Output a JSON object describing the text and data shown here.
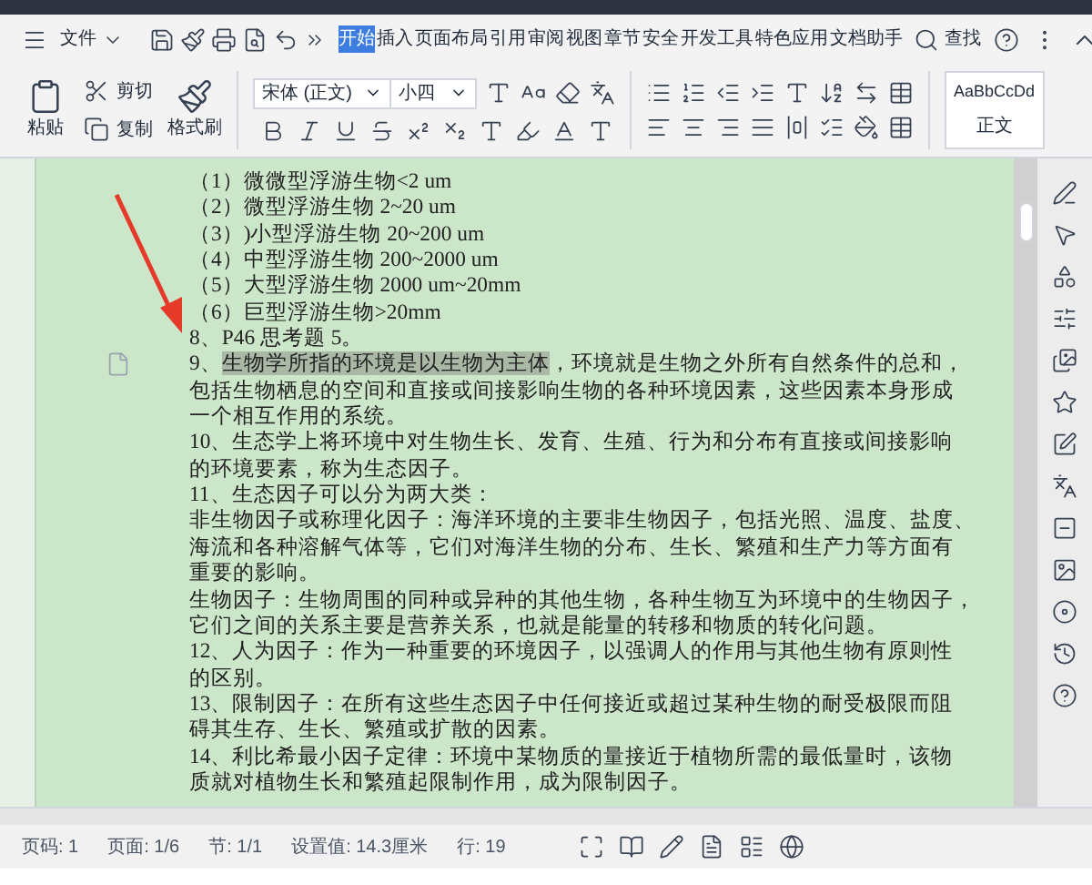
{
  "menu": {
    "file": "文件",
    "tabs": [
      {
        "label": "开始",
        "selected": true
      },
      {
        "label": "插入",
        "selected": false
      },
      {
        "label": "页面布局",
        "selected": false
      },
      {
        "label": "引用",
        "selected": false
      },
      {
        "label": "审阅",
        "selected": false
      },
      {
        "label": "视图",
        "selected": false
      },
      {
        "label": "章节",
        "selected": false
      },
      {
        "label": "安全",
        "selected": false
      },
      {
        "label": "开发工具",
        "selected": false
      },
      {
        "label": "特色应用",
        "selected": false
      },
      {
        "label": "文档助手",
        "selected": false
      }
    ],
    "search": "查找"
  },
  "ribbon": {
    "paste": "粘贴",
    "cut": "剪切",
    "copy": "复制",
    "format_painter": "格式刷",
    "font": "宋体 (正文)",
    "size": "小四",
    "style_preview": "AaBbCcDd",
    "style_name": "正文"
  },
  "document": {
    "lines": [
      {
        "text": "（1）微微型浮游生物<2 um"
      },
      {
        "text": "（2）微型浮游生物 2~20 um"
      },
      {
        "text": "（3）)小型浮游生物 20~200 um"
      },
      {
        "text": "（4）中型浮游生物 200~2000 um"
      },
      {
        "text": "（5）大型浮游生物 2000 um~20mm"
      },
      {
        "text": "（6）巨型浮游生物>20mm"
      },
      {
        "text": "8、P46 思考题 5。"
      },
      {
        "prefix": "9、",
        "highlight": "生物学所指的环境是以生物为主体",
        "text": "，环境就是生物之外所有自然条件的总和，"
      },
      {
        "text": "包括生物栖息的空间和直接或间接影响生物的各种环境因素，这些因素本身形成"
      },
      {
        "text": "一个相互作用的系统。"
      },
      {
        "text": "10、生态学上将环境中对生物生长、发育、生殖、行为和分布有直接或间接影响"
      },
      {
        "text": "的环境要素，称为生态因子。"
      },
      {
        "text": "11、生态因子可以分为两大类："
      },
      {
        "text": "非生物因子或称理化因子：海洋环境的主要非生物因子，包括光照、温度、盐度、"
      },
      {
        "text": "海流和各种溶解气体等，它们对海洋生物的分布、生长、繁殖和生产力等方面有"
      },
      {
        "text": "重要的影响。"
      },
      {
        "text": "生物因子：生物周围的同种或异种的其他生物，各种生物互为环境中的生物因子，"
      },
      {
        "text": "它们之间的关系主要是营养关系，也就是能量的转移和物质的转化问题。"
      },
      {
        "text": "12、人为因子：作为一种重要的环境因子，以强调人的作用与其他生物有原则性"
      },
      {
        "text": "的区别。"
      },
      {
        "text": "13、限制因子：在所有这些生态因子中任何接近或超过某种生物的耐受极限而阻"
      },
      {
        "text": "碍其生存、生长、繁殖或扩散的因素。"
      },
      {
        "text": "14、利比希最小因子定律：环境中某物质的量接近于植物所需的最低量时，该物"
      },
      {
        "text": "质就对植物生长和繁殖起限制作用，成为限制因子。"
      }
    ]
  },
  "status_bar": [
    "页码: 1",
    "页面: 1/6",
    "节: 1/1",
    "设置值: 14.3厘米",
    "行: 19"
  ]
}
